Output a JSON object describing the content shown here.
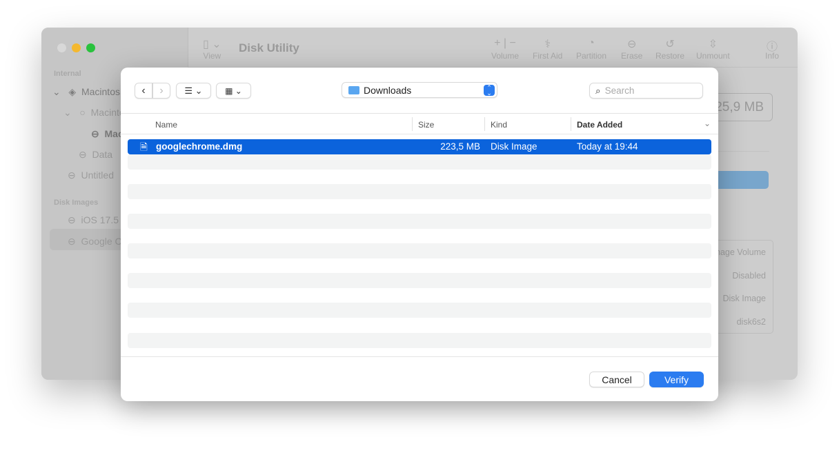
{
  "window": {
    "title": "Disk Utility",
    "sidebar": {
      "sections": [
        "Internal",
        "Disk Images"
      ],
      "items": [
        "Macintosh HD",
        "Macintosh HD",
        "Macintosh HD",
        "Data",
        "Untitled",
        "iOS 17.5",
        "Google Chrome"
      ]
    },
    "toolbar": {
      "view": "View",
      "volume": "Volume",
      "first_aid": "First Aid",
      "partition": "Partition",
      "erase": "Erase",
      "restore": "Restore",
      "unmount": "Unmount",
      "info": "Info"
    },
    "detail": {
      "size": "225,9 MB",
      "rows": [
        "Disk Image Volume",
        "Disabled",
        "Disk Image",
        "disk6s2"
      ]
    }
  },
  "dialog": {
    "location": "Downloads",
    "search_placeholder": "Search",
    "columns": [
      "Name",
      "Size",
      "Kind",
      "Date Added"
    ],
    "files": [
      {
        "name": "googlechrome.dmg",
        "size": "223,5 MB",
        "kind": "Disk Image",
        "date": "Today at 19:44"
      }
    ],
    "cancel": "Cancel",
    "verify": "Verify"
  },
  "colors": {
    "accent": "#0b63dc",
    "button": "#2b7cf0"
  }
}
